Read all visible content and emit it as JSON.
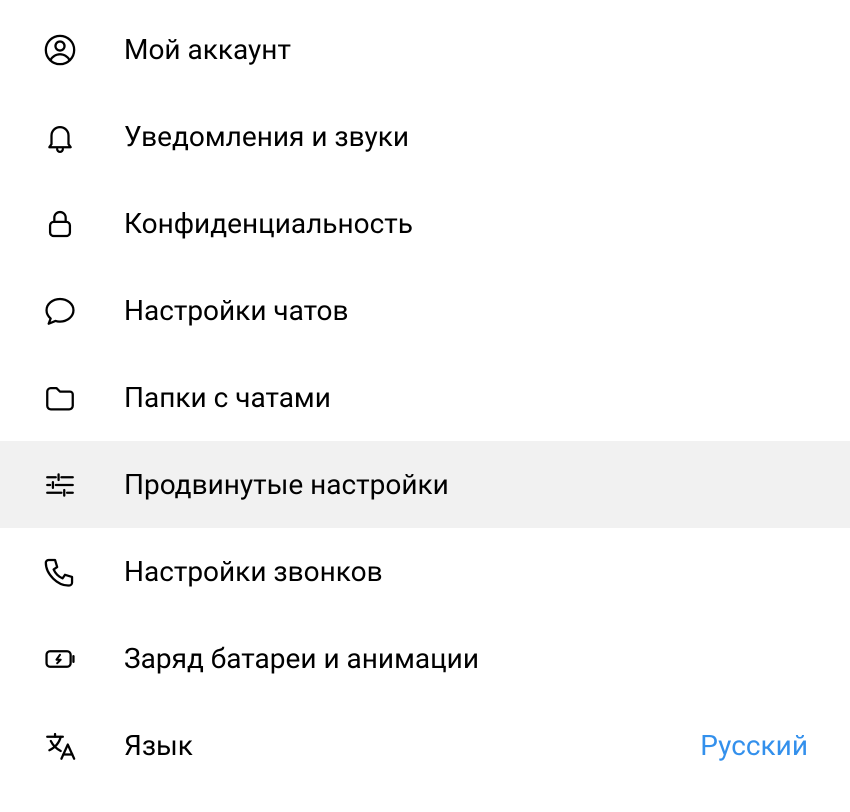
{
  "settings": {
    "items": [
      {
        "label": "Мой аккаунт"
      },
      {
        "label": "Уведомления и звуки"
      },
      {
        "label": "Конфиденциальность"
      },
      {
        "label": "Настройки чатов"
      },
      {
        "label": "Папки с чатами"
      },
      {
        "label": "Продвинутые настройки"
      },
      {
        "label": "Настройки звонков"
      },
      {
        "label": "Заряд батареи и анимации"
      },
      {
        "label": "Язык",
        "value": "Русский"
      }
    ]
  }
}
